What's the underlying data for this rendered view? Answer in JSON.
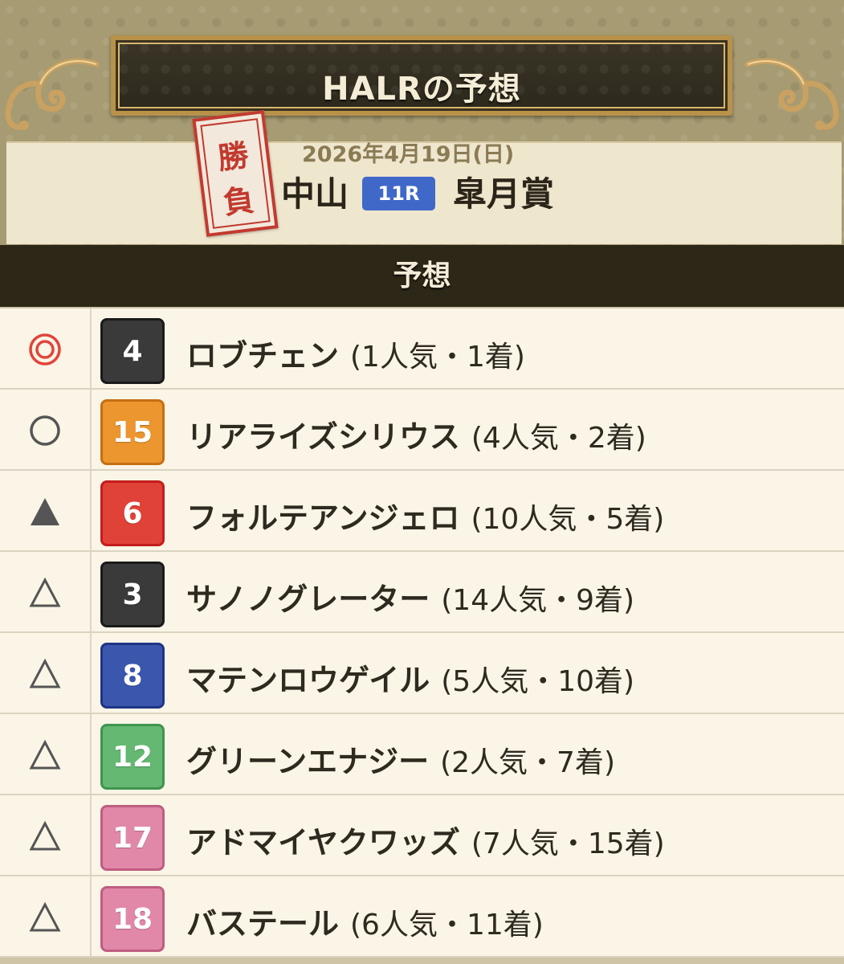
{
  "header": {
    "title": "HALRの予想",
    "stamp_chars": [
      "勝",
      "負"
    ],
    "date": "2026年4月19日(日)",
    "venue": "中山",
    "race_number": "11R",
    "race_name": "皐月賞"
  },
  "section": {
    "title": "予想"
  },
  "colors": {
    "dark_header": "#2d2717",
    "race_badge": "#3f68c9",
    "stamp_red": "#c23a2e",
    "honmei_red": "#e0443c"
  },
  "predictions": [
    {
      "mark": "double-circle",
      "number": "4",
      "box_color": "#3a3a3a",
      "box_border": "#1a1a1a",
      "text_color": "#ffffff",
      "name": "ロブチェン",
      "result": "(1人気・1着)"
    },
    {
      "mark": "circle",
      "number": "15",
      "box_color": "#ec962f",
      "box_border": "#c66f12",
      "text_color": "#ffffff",
      "name": "リアライズシリウス",
      "result": "(4人気・2着)"
    },
    {
      "mark": "filled-triangle",
      "number": "6",
      "box_color": "#e14238",
      "box_border": "#c41d1d",
      "text_color": "#ffffff",
      "name": "フォルテアンジェロ",
      "result": "(10人気・5着)"
    },
    {
      "mark": "triangle",
      "number": "3",
      "box_color": "#3a3a3a",
      "box_border": "#1a1a1a",
      "text_color": "#ffffff",
      "name": "サノノグレーター",
      "result": "(14人気・9着)"
    },
    {
      "mark": "triangle",
      "number": "8",
      "box_color": "#3b57ad",
      "box_border": "#1f3585",
      "text_color": "#ffffff",
      "name": "マテンロウゲイル",
      "result": "(5人気・10着)"
    },
    {
      "mark": "triangle",
      "number": "12",
      "box_color": "#64b872",
      "box_border": "#3f9450",
      "text_color": "#ffffff",
      "name": "グリーンエナジー",
      "result": "(2人気・7着)"
    },
    {
      "mark": "triangle",
      "number": "17",
      "box_color": "#e188a8",
      "box_border": "#c05d82",
      "text_color": "#ffffff",
      "name": "アドマイヤクワッズ",
      "result": "(7人気・15着)"
    },
    {
      "mark": "triangle",
      "number": "18",
      "box_color": "#e188a8",
      "box_border": "#c05d82",
      "text_color": "#ffffff",
      "name": "バステール",
      "result": "(6人気・11着)"
    }
  ]
}
